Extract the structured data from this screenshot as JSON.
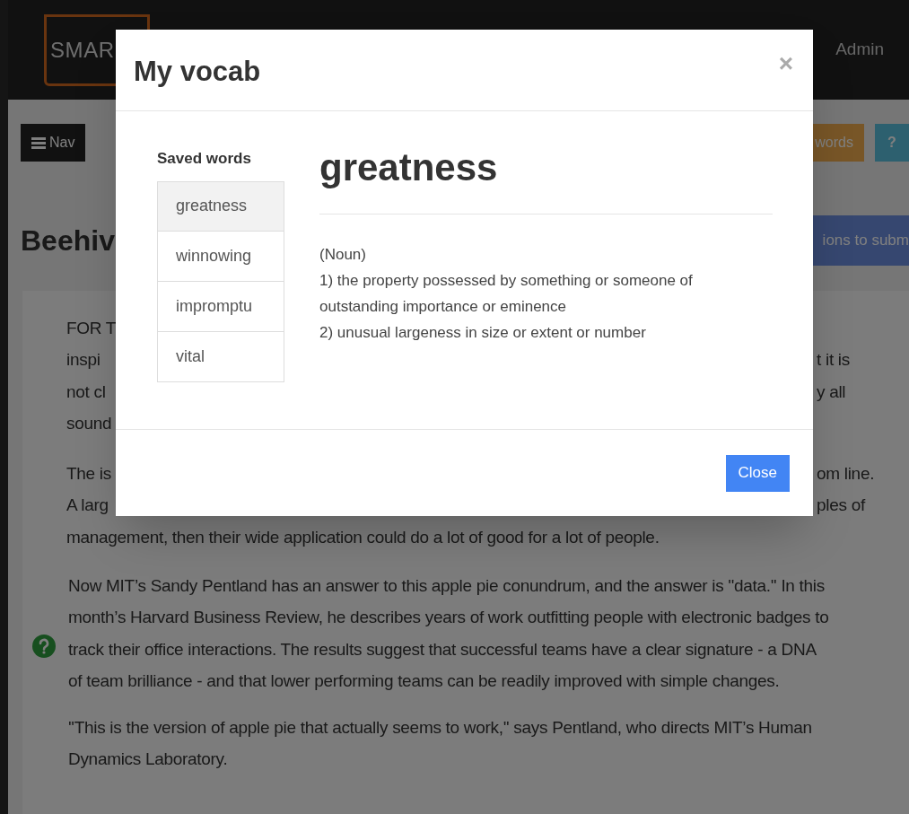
{
  "header": {
    "logo_text": "SMAR",
    "user": "Admin"
  },
  "toolbar": {
    "nav_button": "Nav",
    "words_button": "words",
    "help_button": "?"
  },
  "page_title": "Beehiv",
  "submit_button": "ions to subm",
  "article": {
    "lines": [
      {
        "left": "FOR T"
      },
      {
        "left": "inspi",
        "right": "t it is"
      },
      {
        "left": "not cl",
        "right": "y all"
      },
      {
        "left": "sound"
      }
    ],
    "lines_2": [
      {
        "left": "The is",
        "right": "om line."
      },
      {
        "left": "A larg",
        "right": "ples of"
      },
      {
        "left": "management, then their wide application could do a lot of good for a lot of people."
      }
    ],
    "paragraphs": [
      {
        "text": "Now MIT’s Sandy Pentland has an answer to this apple pie conundrum, and the answer is ''data.'' In this month’s Harvard Business Review, he describes years of work outfitting people with electronic badges to track their office interactions. The results suggest that successful teams have a clear signature - a DNA of team brilliance - and that lower performing teams can be readily improved with simple changes.",
        "has_help": true
      },
      {
        "text": "''This is the version of apple pie that actually seems to work,'' says Pentland, who directs MIT’s Human Dynamics Laboratory.",
        "has_help": false
      }
    ]
  },
  "modal": {
    "title": "My vocab",
    "close_icon": "×",
    "saved_words_label": "Saved words",
    "words": [
      {
        "text": "greatness",
        "selected": true
      },
      {
        "text": "winnowing",
        "selected": false
      },
      {
        "text": "impromptu",
        "selected": false
      },
      {
        "text": "vital",
        "selected": false
      }
    ],
    "definition": {
      "word": "greatness",
      "part_of_speech": "(Noun)",
      "senses": [
        "1) the property possessed by something or someone of outstanding importance or eminence",
        "2) unusual largeness in size or extent or number"
      ]
    },
    "close_button": "Close"
  }
}
